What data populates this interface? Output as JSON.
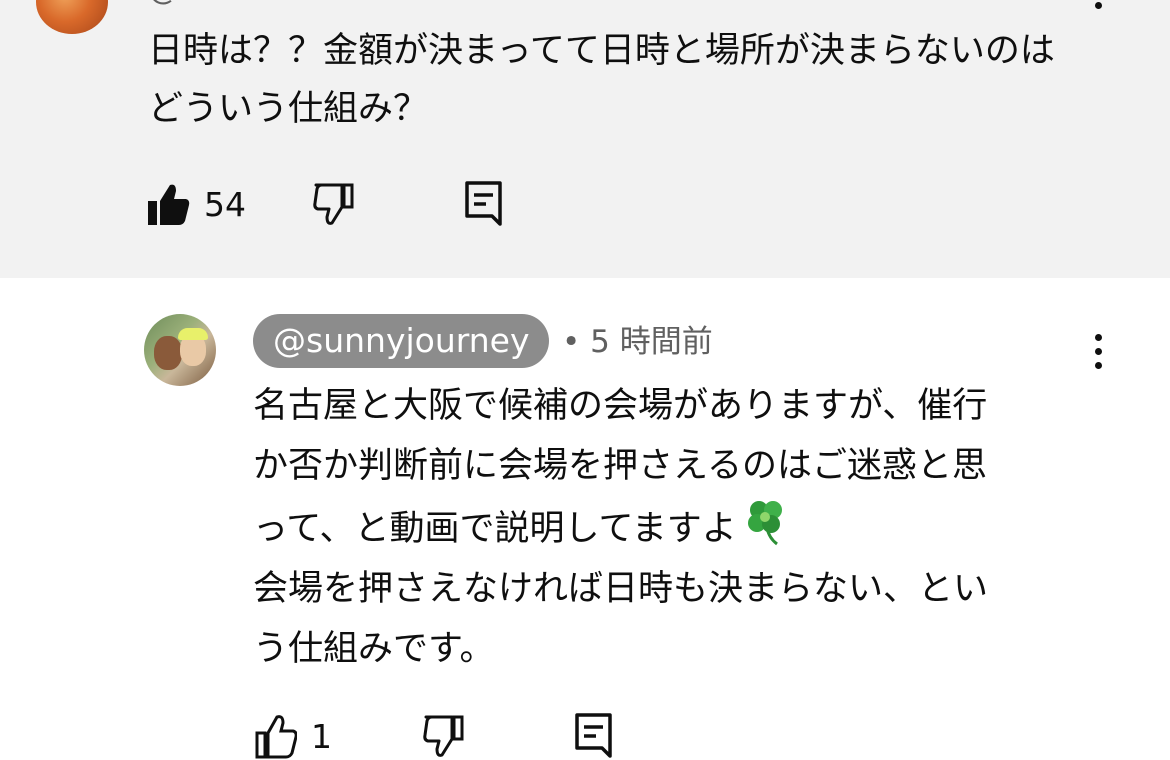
{
  "comments": [
    {
      "author": "@ ",
      "avatar": "avatar-image",
      "text": "日時は？？金額が決まってて日時と場所が決まらないのはどういう仕組み？",
      "like_count": "54",
      "background": "#f2f2f2"
    },
    {
      "author": "@sunnyjourney",
      "separator": "•",
      "time": "5 時間前",
      "text_lines": [
        "名古屋と大阪で候補の会場がありますが、催行",
        "か否か判断前に会場を押さえるのはご迷惑と思",
        "って、と動画で説明してますよ",
        "会場を押さえなければ日時も決まらない、とい",
        "う仕組みです。"
      ],
      "emoji": "four-leaf-clover",
      "like_count": "1",
      "author_chip_color": "#8c8c8c"
    }
  ],
  "icons": {
    "like": "thumbs-up-icon",
    "dislike": "thumbs-down-icon",
    "reply": "reply-comment-icon",
    "menu": "more-vertical-icon"
  },
  "colors": {
    "text": "#0f0f0f",
    "secondary": "#606060"
  }
}
